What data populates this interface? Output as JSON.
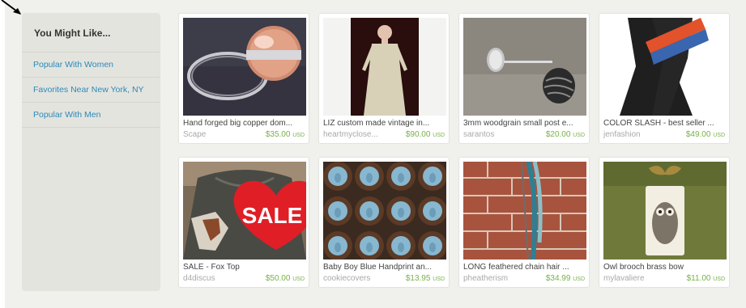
{
  "sidebar": {
    "title": "You Might Like...",
    "links": [
      "Popular With Women",
      "Favorites Near New York, NY",
      "Popular With Men"
    ]
  },
  "items": [
    {
      "title": "Hand forged big copper dom...",
      "shop": "Scape",
      "price": "$35.00",
      "currency": "USD",
      "image": "copper-ring-image"
    },
    {
      "title": "LIZ custom made vintage in...",
      "shop": "heartmyclose...",
      "price": "$90.00",
      "currency": "USD",
      "image": "vintage-dress-image"
    },
    {
      "title": "3mm woodgrain small post e...",
      "shop": "sarantos",
      "price": "$20.00",
      "currency": "USD",
      "image": "post-earrings-image"
    },
    {
      "title": "COLOR SLASH - best seller ...",
      "shop": "jenfashion",
      "price": "$49.00",
      "currency": "USD",
      "image": "jumpsuit-image"
    },
    {
      "title": "SALE - Fox Top",
      "shop": "d4discus",
      "price": "$50.00",
      "currency": "USD",
      "image": "fox-top-image",
      "badge": "SALE"
    },
    {
      "title": "Baby Boy Blue Handprint an...",
      "shop": "cookiecovers",
      "price": "$13.95",
      "currency": "USD",
      "image": "handprint-cookies-image"
    },
    {
      "title": "LONG feathered chain hair ...",
      "shop": "pheatherism",
      "price": "$34.99",
      "currency": "USD",
      "image": "feather-hair-image"
    },
    {
      "title": "Owl brooch brass bow",
      "shop": "mylavaliere",
      "price": "$11.00",
      "currency": "USD",
      "image": "owl-brooch-image"
    }
  ]
}
